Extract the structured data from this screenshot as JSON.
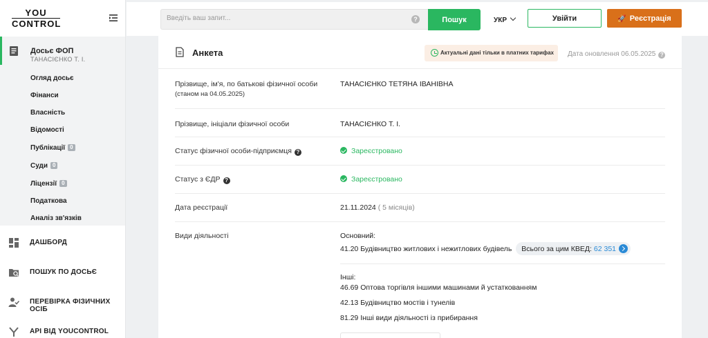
{
  "logo": {
    "line1": "YOU",
    "line2": "CONTROL"
  },
  "sidebar": {
    "dossier": {
      "title": "Досьє ФОП",
      "subtitle": "ТАНАСІЄНКО Т. І."
    },
    "sub_items": [
      {
        "label": "Огляд досьє"
      },
      {
        "label": "Фінанси"
      },
      {
        "label": "Власність"
      },
      {
        "label": "Відомості"
      },
      {
        "label": "Публікації",
        "badge": "0"
      },
      {
        "label": "Суди",
        "badge": "0"
      },
      {
        "label": "Ліцензії",
        "badge": "0"
      },
      {
        "label": "Податкова"
      },
      {
        "label": "Аналіз зв'язків"
      }
    ],
    "nav": [
      {
        "label": "ДАШБОРД",
        "icon": "dashboard-icon"
      },
      {
        "label": "ПОШУК ПО ДОСЬЄ",
        "icon": "folder-search-icon"
      },
      {
        "label": "ПЕРЕВІРКА ФІЗИЧНИХ ОСІБ",
        "icon": "person-check-icon"
      },
      {
        "label": "API ВІД YOUCONTROL",
        "icon": "api-icon"
      }
    ]
  },
  "header": {
    "search_placeholder": "Введіть ваш запит...",
    "search_button": "Пошук",
    "language": "УКР",
    "login_button": "Увійти",
    "register_button": "Реєстрація"
  },
  "card": {
    "title": "Анкета",
    "notice": "Актуальні дані тільки в платних тарифах",
    "updated": "Дата оновлення 06.05.2025",
    "rows": {
      "full_name": {
        "label": "Прізвище, ім'я, по батькові фізичної особи",
        "note": "(станом на 04.05.2025)",
        "value": "ТАНАСІЄНКО ТЕТЯНА ІВАНІВНА"
      },
      "short_name": {
        "label": "Прізвище, ініціали фізичної особи",
        "value": "ТАНАСІЄНКО Т. І."
      },
      "status_fop": {
        "label": "Статус фізичної особи-підприємця",
        "value": "Зареєстровано"
      },
      "status_edr": {
        "label": "Статус з ЄДР",
        "value": "Зареєстровано"
      },
      "reg_date": {
        "label": "Дата реєстрації",
        "value": "21.11.2024",
        "extra": "( 5 місяців)"
      },
      "activities": {
        "label": "Види діяльності",
        "main_label": "Основний:",
        "main_value": "41.20 Будівництво житлових і нежитлових будівель",
        "kved_total_label": "Всього за цим КВЕД:",
        "kved_total_value": "62 351",
        "other_label": "Інші:",
        "others": [
          "46.69 Оптова торгівля іншими машинами й устаткованням",
          "42.13 Будівництво мостів і тунелів",
          "81.29 Інші види діяльності із прибирання"
        ]
      }
    }
  }
}
